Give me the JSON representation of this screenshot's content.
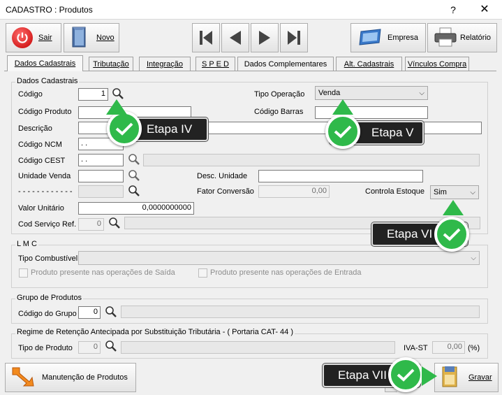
{
  "window": {
    "title": "CADASTRO : Produtos",
    "help": "?",
    "close": "✕"
  },
  "toolbar": {
    "sair": "Sair",
    "novo": "Novo",
    "empresa": "Empresa",
    "relatorio": "Relatório"
  },
  "tabs": [
    "Dados Cadastrais",
    "Tributação",
    "Integração",
    "S P E D",
    "Dados Complementares",
    "Alt. Cadastrais",
    "Vínculos Compra"
  ],
  "dados": {
    "group": "Dados Cadastrais",
    "codigo_label": "Código",
    "codigo_value": "1",
    "codigo_produto_label": "Código Produto",
    "descricao_label": "Descrição",
    "ncm_label": "Código NCM",
    "ncm_value": " .  .",
    "cest_label": "Código CEST",
    "cest_value": " .  .",
    "unidade_label": "Unidade Venda",
    "dashes_label": "- - - - - - - - - - - -",
    "valor_label": "Valor Unitário",
    "valor_value": "0,0000000000",
    "servico_label": "Cod Serviço Ref.",
    "servico_value": "0",
    "tipo_operacao_label": "Tipo Operação",
    "tipo_operacao_value": "Venda",
    "codigo_barras_label": "Código Barras",
    "desc_unidade_label": "Desc. Unidade",
    "fator_label": "Fator Conversão",
    "fator_value": "0,00",
    "controla_label": "Controla Estoque",
    "controla_value": "Sim"
  },
  "lmc": {
    "group": "L M C",
    "tipo_label": "Tipo Combustível",
    "saida_label": "Produto presente nas operações de Saída",
    "entrada_label": "Produto presente nas operações de Entrada"
  },
  "grupo": {
    "group": "Grupo de Produtos",
    "codigo_label": "Código do Grupo",
    "codigo_value": "0"
  },
  "regime": {
    "group": "Regime de Retenção Antecipada por Substituição Tributária - ( Portaria CAT- 44 )",
    "tipo_label": "Tipo de Produto",
    "tipo_value": "0",
    "iva_label": "IVA-ST",
    "iva_value": "0,00",
    "iva_unit": "(%)"
  },
  "footer": {
    "manutencao": "Manutenção de Produtos",
    "gravar": "Gravar"
  },
  "callouts": {
    "iv": "Etapa IV",
    "v": "Etapa V",
    "vi": "Etapa VI",
    "vii": "Etapa VII"
  },
  "colors": {
    "accent_green": "#2fb94a",
    "callout_bg": "#222222"
  }
}
